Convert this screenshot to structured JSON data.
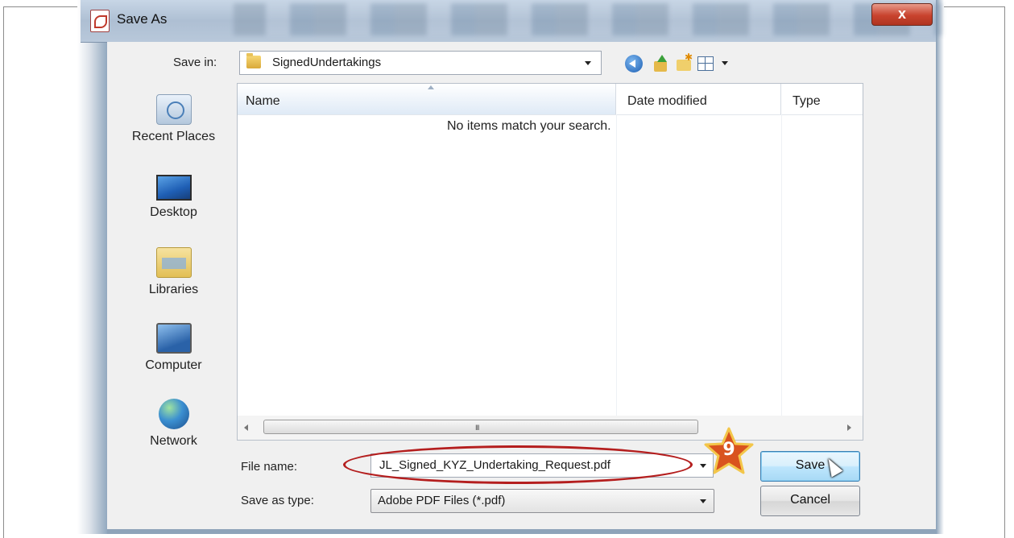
{
  "window": {
    "title": "Save As",
    "close_label": "x"
  },
  "toolbar": {
    "save_in_label": "Save in:",
    "save_in_value": "SignedUndertakings",
    "back_icon": "back-arrow-icon",
    "up_icon": "up-one-level-icon",
    "new_folder_icon": "new-folder-icon",
    "views_icon": "views-menu-icon"
  },
  "places": [
    {
      "label": "Recent Places",
      "icon": "recent-places-icon"
    },
    {
      "label": "Desktop",
      "icon": "desktop-icon"
    },
    {
      "label": "Libraries",
      "icon": "libraries-icon"
    },
    {
      "label": "Computer",
      "icon": "computer-icon"
    },
    {
      "label": "Network",
      "icon": "network-icon"
    }
  ],
  "filelist": {
    "columns": [
      "Name",
      "Date modified",
      "Type"
    ],
    "empty_message": "No items match your search.",
    "scroll_grip": "III"
  },
  "form": {
    "file_name_label": "File name:",
    "file_name_value": "JL_Signed_KYZ_Undertaking_Request.pdf",
    "save_as_type_label": "Save as type:",
    "save_as_type_value": "Adobe PDF Files (*.pdf)"
  },
  "buttons": {
    "save": "Save",
    "cancel": "Cancel"
  },
  "annotation": {
    "step_number": "9",
    "highlight_color": "#b41e1e",
    "badge_color": "#d9531e"
  },
  "colors": {
    "titlebar": "#aebfd3",
    "dialog_bg": "#f0f0f0",
    "close_button": "#c8432e"
  }
}
